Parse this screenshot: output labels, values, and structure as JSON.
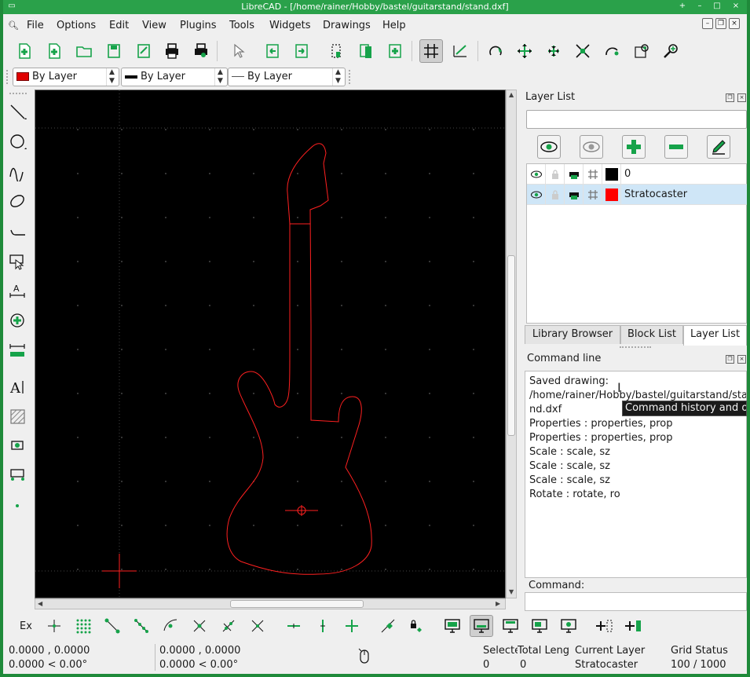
{
  "window": {
    "title": "LibreCAD - [/home/rainer/Hobby/bastel/guitarstand/stand.dxf]",
    "controls": [
      "+",
      "–",
      "□",
      "×"
    ]
  },
  "menu": {
    "items": [
      "File",
      "Options",
      "Edit",
      "View",
      "Plugins",
      "Tools",
      "Widgets",
      "Drawings",
      "Help"
    ]
  },
  "properties": {
    "color": "By Layer",
    "width": "By Layer",
    "linetype": "By Layer",
    "color_swatch": "#e00000"
  },
  "layer_list": {
    "title": "Layer List",
    "filter_placeholder": "",
    "layers": [
      {
        "name": "0",
        "color": "#000000",
        "selected": false
      },
      {
        "name": "Stratocaster",
        "color": "#ff0000",
        "selected": true
      }
    ]
  },
  "dock_tabs": [
    "Library Browser",
    "Block List",
    "Layer List"
  ],
  "command_line": {
    "title": "Command line",
    "history": [
      "Saved drawing:",
      "/home/rainer/Hobby/bastel/guitarstand/sta",
      "nd.dxf",
      "Properties : properties, prop",
      "Properties : properties, prop",
      "Scale : scale, sz",
      "Scale : scale, sz",
      "Scale : scale, sz",
      "Rotate : rotate, ro"
    ],
    "tooltip": "Command history and ou",
    "prompt": "Command:"
  },
  "snap": {
    "ex_label": "Ex"
  },
  "status": {
    "abs_coord": "0.0000 , 0.0000",
    "abs_polar": "0.0000 < 0.00°",
    "rel_coord": "0.0000 , 0.0000",
    "rel_polar": "0.0000 < 0.00°",
    "selected_label": "Selecte",
    "selected_value": "0",
    "total_length_label": "Total Leng",
    "total_length_value": "0",
    "current_layer_label": "Current Layer",
    "current_layer_value": "Stratocaster",
    "grid_status_label": "Grid Status",
    "grid_status_value": "100 / 1000"
  },
  "colors": {
    "accent": "#2aa14a",
    "icon_green": "#16a34a",
    "drawing": "#ff2020",
    "selection": "#cfe6f7"
  }
}
